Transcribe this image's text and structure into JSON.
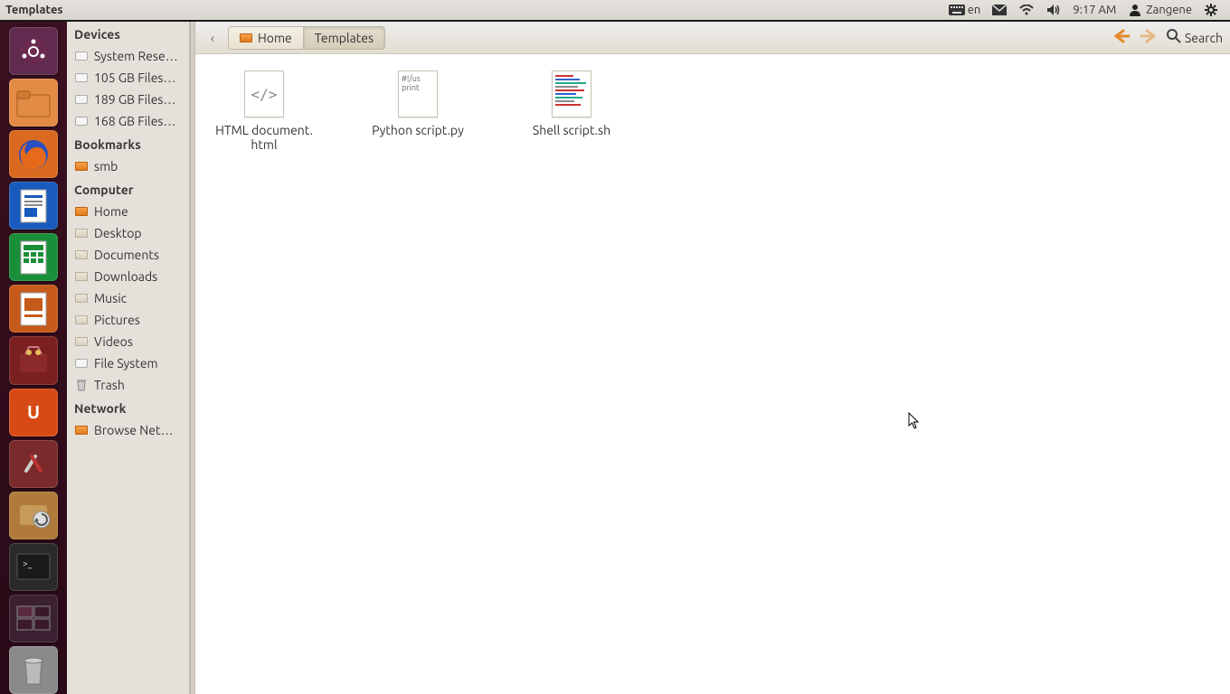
{
  "top_panel": {
    "app_title": "Templates",
    "keyboard_layout": "en",
    "clock": "9:17 AM",
    "username": "Zangene"
  },
  "launcher_tiles": [
    {
      "name": "dash",
      "color": "#602b4f"
    },
    {
      "name": "nautilus",
      "color": "#e28b45"
    },
    {
      "name": "firefox",
      "color": "#d96a20"
    },
    {
      "name": "writer",
      "color": "#185abd"
    },
    {
      "name": "calc",
      "color": "#1a8f3a"
    },
    {
      "name": "impress",
      "color": "#c55a1a"
    },
    {
      "name": "software-center",
      "color": "#7a2020"
    },
    {
      "name": "ubuntu-one",
      "color": "#d84a15"
    },
    {
      "name": "settings",
      "color": "#7a2a2a"
    },
    {
      "name": "software-updater",
      "color": "#b07a3a"
    },
    {
      "name": "terminal",
      "color": "#2a2a2a"
    },
    {
      "name": "workspace",
      "color": "#3a2030"
    },
    {
      "name": "trash",
      "color": "#8a8a8a"
    }
  ],
  "sidebar": {
    "sections": [
      {
        "title": "Devices",
        "items": [
          {
            "id": "sysres",
            "icon": "hdd",
            "label": "System Rese…"
          },
          {
            "id": "fs105",
            "icon": "hdd",
            "label": "105 GB Files…"
          },
          {
            "id": "fs189",
            "icon": "hdd",
            "label": "189 GB Files…"
          },
          {
            "id": "fs168",
            "icon": "hdd",
            "label": "168 GB Files…"
          }
        ]
      },
      {
        "title": "Bookmarks",
        "items": [
          {
            "id": "smb",
            "icon": "fld-orange",
            "label": "smb"
          }
        ]
      },
      {
        "title": "Computer",
        "items": [
          {
            "id": "home",
            "icon": "fld-orange",
            "label": "Home"
          },
          {
            "id": "desktop",
            "icon": "fld-plain",
            "label": "Desktop"
          },
          {
            "id": "documents",
            "icon": "fld-plain",
            "label": "Documents"
          },
          {
            "id": "downloads",
            "icon": "fld-plain",
            "label": "Downloads"
          },
          {
            "id": "music",
            "icon": "fld-plain",
            "label": "Music"
          },
          {
            "id": "pictures",
            "icon": "fld-plain",
            "label": "Pictures"
          },
          {
            "id": "videos",
            "icon": "fld-plain",
            "label": "Videos"
          },
          {
            "id": "filesystem",
            "icon": "hdd",
            "label": "File System"
          },
          {
            "id": "trash",
            "icon": "trash",
            "label": "Trash"
          }
        ]
      },
      {
        "title": "Network",
        "items": [
          {
            "id": "browse-net",
            "icon": "fld-orange",
            "label": "Browse Net…"
          }
        ]
      }
    ]
  },
  "pathbar": {
    "back_hint": "‹",
    "crumbs": [
      {
        "label": "Home",
        "active": false
      },
      {
        "label": "Templates",
        "active": true
      }
    ],
    "search_label": "Search"
  },
  "files": [
    {
      "name": "HTML document.html",
      "thumb": "html",
      "preview": "</>"
    },
    {
      "name": "Python script.py",
      "thumb": "py",
      "preview": "#!/us\nprint"
    },
    {
      "name": "Shell script.sh",
      "thumb": "sh",
      "preview": ""
    }
  ]
}
